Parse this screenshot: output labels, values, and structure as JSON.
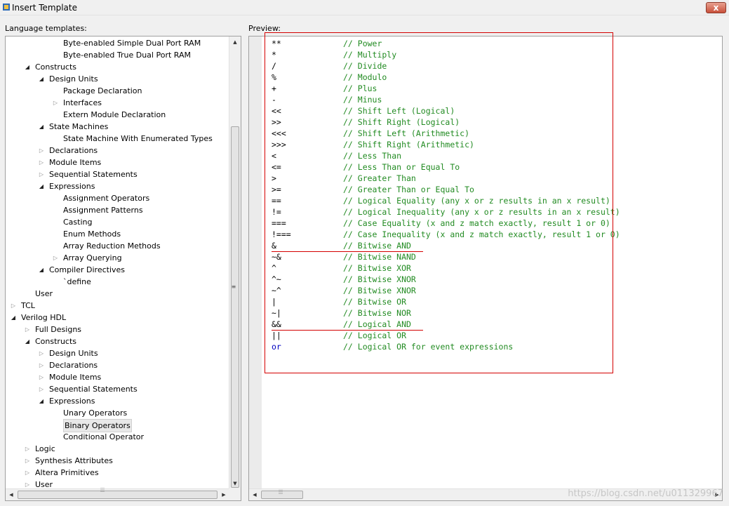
{
  "window": {
    "title": "Insert Template",
    "close_label": "x"
  },
  "labels": {
    "templates": "Language templates:",
    "preview": "Preview:"
  },
  "tree": [
    {
      "label": "Byte-enabled Simple Dual Port RAM",
      "level": 4,
      "toggle": "none"
    },
    {
      "label": "Byte-enabled True Dual Port RAM",
      "level": 4,
      "toggle": "none"
    },
    {
      "label": "Constructs",
      "level": 2,
      "toggle": "expanded"
    },
    {
      "label": "Design Units",
      "level": 3,
      "toggle": "expanded"
    },
    {
      "label": "Package Declaration",
      "level": 4,
      "toggle": "none"
    },
    {
      "label": "Interfaces",
      "level": 4,
      "toggle": "collapsed"
    },
    {
      "label": "Extern Module Declaration",
      "level": 4,
      "toggle": "none"
    },
    {
      "label": "State Machines",
      "level": 3,
      "toggle": "expanded"
    },
    {
      "label": "State Machine With Enumerated Types",
      "level": 4,
      "toggle": "none"
    },
    {
      "label": "Declarations",
      "level": 3,
      "toggle": "collapsed"
    },
    {
      "label": "Module Items",
      "level": 3,
      "toggle": "collapsed"
    },
    {
      "label": "Sequential Statements",
      "level": 3,
      "toggle": "collapsed"
    },
    {
      "label": "Expressions",
      "level": 3,
      "toggle": "expanded"
    },
    {
      "label": "Assignment Operators",
      "level": 4,
      "toggle": "none"
    },
    {
      "label": "Assignment Patterns",
      "level": 4,
      "toggle": "none"
    },
    {
      "label": "Casting",
      "level": 4,
      "toggle": "none"
    },
    {
      "label": "Enum Methods",
      "level": 4,
      "toggle": "none"
    },
    {
      "label": "Array Reduction Methods",
      "level": 4,
      "toggle": "none"
    },
    {
      "label": "Array Querying",
      "level": 4,
      "toggle": "collapsed"
    },
    {
      "label": "Compiler Directives",
      "level": 3,
      "toggle": "expanded"
    },
    {
      "label": "`define",
      "level": 4,
      "toggle": "none"
    },
    {
      "label": "User",
      "level": 2,
      "toggle": "none"
    },
    {
      "label": "TCL",
      "level": 1,
      "toggle": "collapsed"
    },
    {
      "label": "Verilog HDL",
      "level": 1,
      "toggle": "expanded"
    },
    {
      "label": "Full Designs",
      "level": 2,
      "toggle": "collapsed"
    },
    {
      "label": "Constructs",
      "level": 2,
      "toggle": "expanded"
    },
    {
      "label": "Design Units",
      "level": 3,
      "toggle": "collapsed"
    },
    {
      "label": "Declarations",
      "level": 3,
      "toggle": "collapsed"
    },
    {
      "label": "Module Items",
      "level": 3,
      "toggle": "collapsed"
    },
    {
      "label": "Sequential Statements",
      "level": 3,
      "toggle": "collapsed"
    },
    {
      "label": "Expressions",
      "level": 3,
      "toggle": "expanded"
    },
    {
      "label": "Unary Operators",
      "level": 4,
      "toggle": "none"
    },
    {
      "label": "Binary Operators",
      "level": 4,
      "toggle": "none",
      "selected": true
    },
    {
      "label": "Conditional Operator",
      "level": 4,
      "toggle": "none"
    },
    {
      "label": "Logic",
      "level": 2,
      "toggle": "collapsed"
    },
    {
      "label": "Synthesis Attributes",
      "level": 2,
      "toggle": "collapsed"
    },
    {
      "label": "Altera Primitives",
      "level": 2,
      "toggle": "collapsed"
    },
    {
      "label": "User",
      "level": 2,
      "toggle": "collapsed"
    }
  ],
  "preview_lines": [
    {
      "op": "**",
      "comment": "// Power"
    },
    {
      "op": "*",
      "comment": "// Multiply"
    },
    {
      "op": "/",
      "comment": "// Divide"
    },
    {
      "op": "%",
      "comment": "// Modulo"
    },
    {
      "op": "+",
      "comment": "// Plus"
    },
    {
      "op": "-",
      "comment": "// Minus"
    },
    {
      "op": "<<",
      "comment": "// Shift Left (Logical)"
    },
    {
      "op": ">>",
      "comment": "// Shift Right (Logical)"
    },
    {
      "op": "<<<",
      "comment": "// Shift Left (Arithmetic)"
    },
    {
      "op": ">>>",
      "comment": "// Shift Right (Arithmetic)"
    },
    {
      "op": "<",
      "comment": "// Less Than"
    },
    {
      "op": "<=",
      "comment": "// Less Than or Equal To"
    },
    {
      "op": ">",
      "comment": "// Greater Than"
    },
    {
      "op": ">=",
      "comment": "// Greater Than or Equal To"
    },
    {
      "op": "==",
      "comment": "// Logical Equality (any x or z results in an x result)"
    },
    {
      "op": "!=",
      "comment": "// Logical Inequality (any x or z results in an x result)"
    },
    {
      "op": "===",
      "comment": "// Case Equality (x and z match exactly, result 1 or 0)"
    },
    {
      "op": "!===",
      "comment": "// Case Inequality (x and z match exactly, result 1 or 0)"
    },
    {
      "op": "&",
      "comment": "// Bitwise AND",
      "underline": true
    },
    {
      "op": "~&",
      "comment": "// Bitwise NAND"
    },
    {
      "op": "^",
      "comment": "// Bitwise XOR"
    },
    {
      "op": "^~",
      "comment": "// Bitwise XNOR"
    },
    {
      "op": "~^",
      "comment": "// Bitwise XNOR"
    },
    {
      "op": "|",
      "comment": "// Bitwise OR"
    },
    {
      "op": "~|",
      "comment": "// Bitwise NOR"
    },
    {
      "op": "&&",
      "comment": "// Logical AND",
      "underline": true
    },
    {
      "op": "||",
      "comment": "// Logical OR"
    },
    {
      "op": "or",
      "comment": "// Logical OR for event expressions",
      "keyword": true
    }
  ],
  "colors": {
    "comment": "#228b22",
    "keyword": "#0000c0",
    "annotation": "#d40000"
  },
  "watermark": "https://blog.csdn.net/u011329967"
}
